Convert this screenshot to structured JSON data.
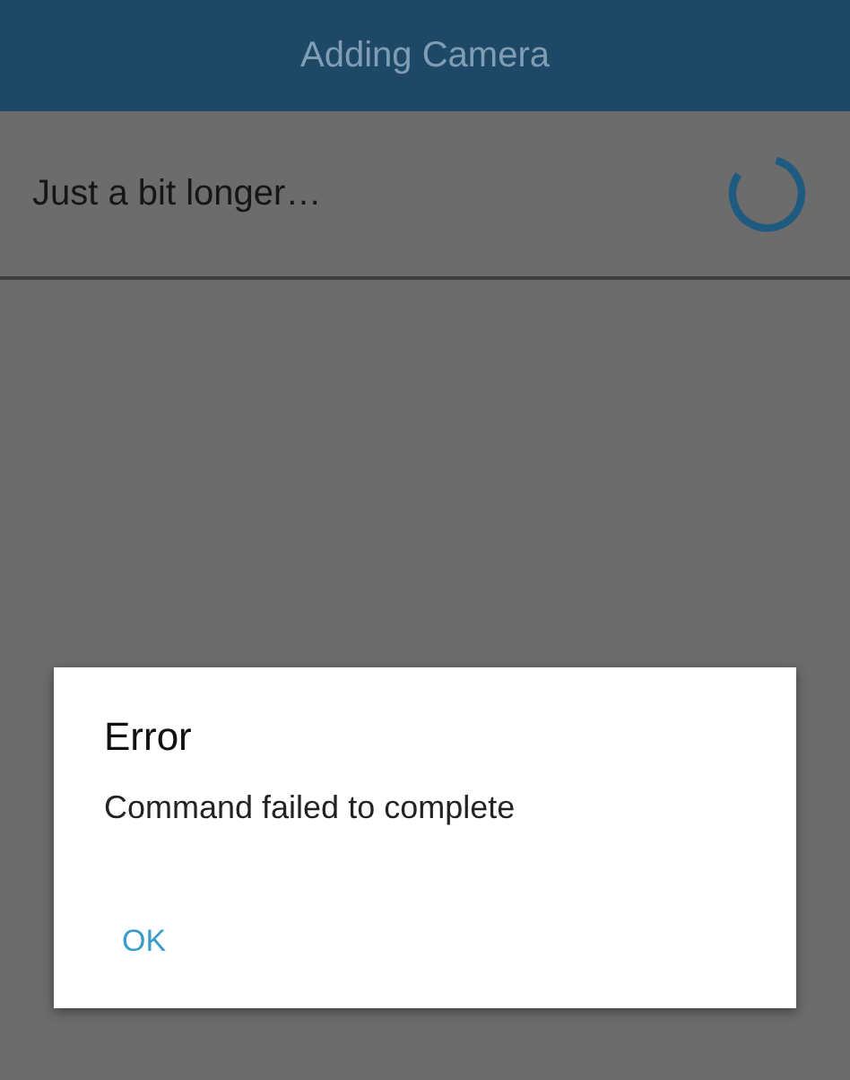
{
  "app_bar": {
    "title": "Adding Camera"
  },
  "status_row": {
    "message": "Just a bit longer…",
    "loading": true
  },
  "dialog": {
    "title": "Error",
    "message": "Command failed to complete",
    "buttons": [
      "OK"
    ]
  }
}
